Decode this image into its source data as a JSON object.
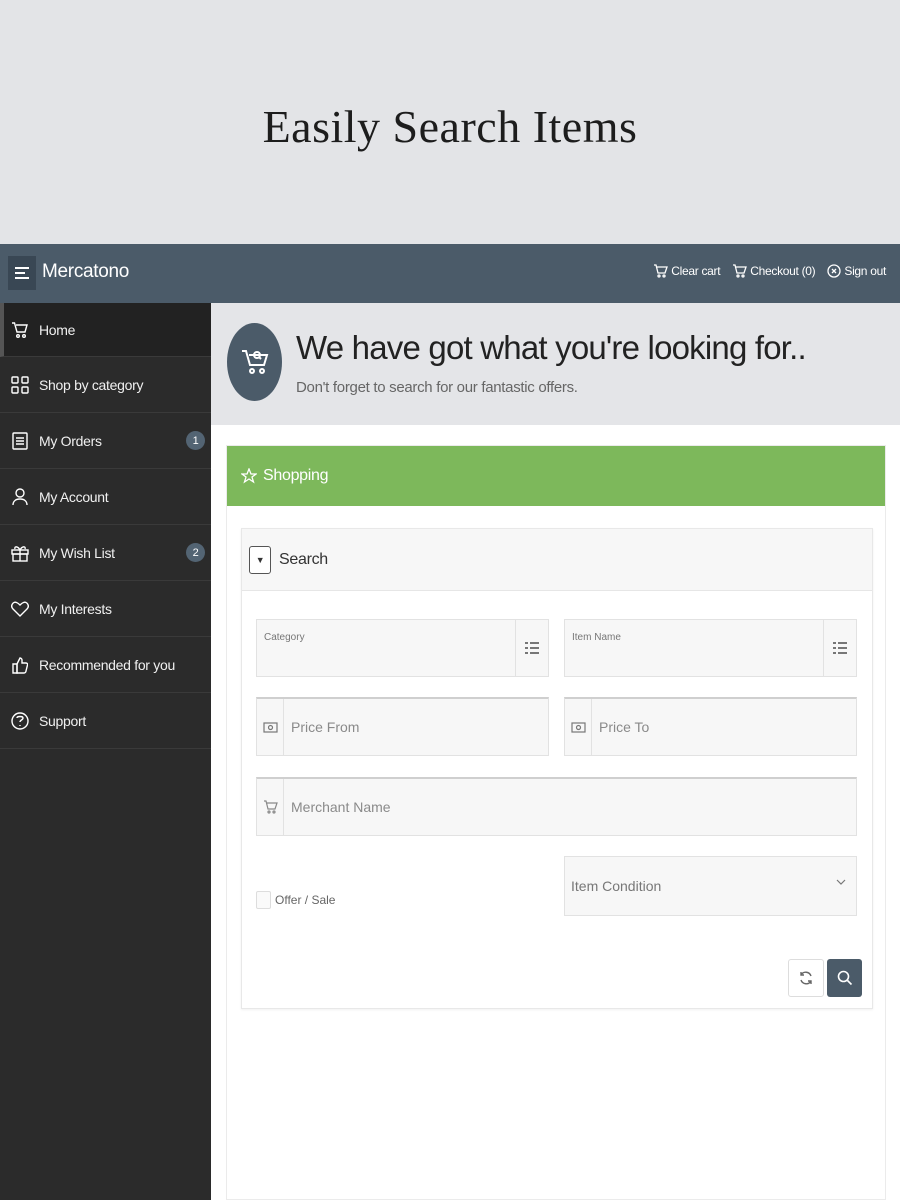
{
  "promo": {
    "title": "Easily Search Items"
  },
  "topbar": {
    "brand": "Mercatono",
    "actions": [
      {
        "label": "Clear cart",
        "icon": "cart-icon"
      },
      {
        "label": "Checkout (0)",
        "icon": "cart-icon"
      },
      {
        "label": "Sign out",
        "icon": "power-icon"
      }
    ]
  },
  "sidebar": {
    "items": [
      {
        "label": "Home",
        "icon": "cart-icon",
        "active": true
      },
      {
        "label": "Shop by category",
        "icon": "grid-icon"
      },
      {
        "label": "My Orders",
        "icon": "list-icon",
        "badge": "1"
      },
      {
        "label": "My Account",
        "icon": "user-icon"
      },
      {
        "label": "My Wish List",
        "icon": "gift-icon",
        "badge": "2"
      },
      {
        "label": "My Interests",
        "icon": "heart-icon"
      },
      {
        "label": "Recommended for you",
        "icon": "thumbs-up-icon"
      },
      {
        "label": "Support",
        "icon": "support-icon"
      }
    ]
  },
  "hero": {
    "title": "We have got what you're looking for..",
    "subtitle": "Don't forget to search for our fantastic offers."
  },
  "panel": {
    "title": "Shopping"
  },
  "search": {
    "title": "Search",
    "category_label": "Category",
    "item_name_label": "Item Name",
    "price_from_placeholder": "Price From",
    "price_to_placeholder": "Price To",
    "merchant_placeholder": "Merchant Name",
    "offer_label": "Offer / Sale",
    "condition_placeholder": "Item Condition"
  },
  "colors": {
    "topbar": "#4b5b69",
    "sidebar": "#2b2b2b",
    "panel_header": "#7db85b",
    "badge": "#536473"
  }
}
